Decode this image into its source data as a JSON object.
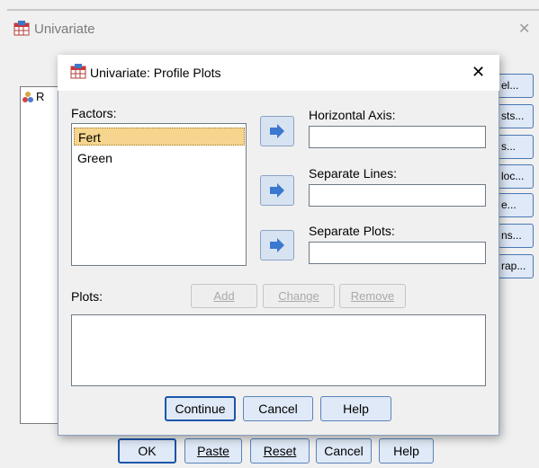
{
  "outer_window": {
    "title": "Univariate",
    "close": "✕",
    "list_glyph": "R",
    "side_buttons": [
      "el...",
      "sts...",
      "s...",
      "loc...",
      "e...",
      "ns...",
      "rap..."
    ],
    "buttons": {
      "ok": "OK",
      "paste": "Paste",
      "reset": "Reset",
      "cancel": "Cancel",
      "help": "Help"
    }
  },
  "dialog": {
    "title": "Univariate: Profile Plots",
    "close": "✕",
    "factors_label": "Factors:",
    "factors": [
      "Fert",
      "Green"
    ],
    "horizontal_axis_label": "Horizontal Axis:",
    "separate_lines_label": "Separate Lines:",
    "separate_plots_label": "Separate Plots:",
    "horizontal_axis_value": "",
    "separate_lines_value": "",
    "separate_plots_value": "",
    "plots_label": "Plots:",
    "add": "Add",
    "change": "Change",
    "remove": "Remove",
    "continue": "Continue",
    "cancel": "Cancel",
    "help": "Help"
  },
  "colors": {
    "accent": "#1c56a9",
    "selection": "#f6d68e",
    "arrow": "#3b78d0"
  }
}
